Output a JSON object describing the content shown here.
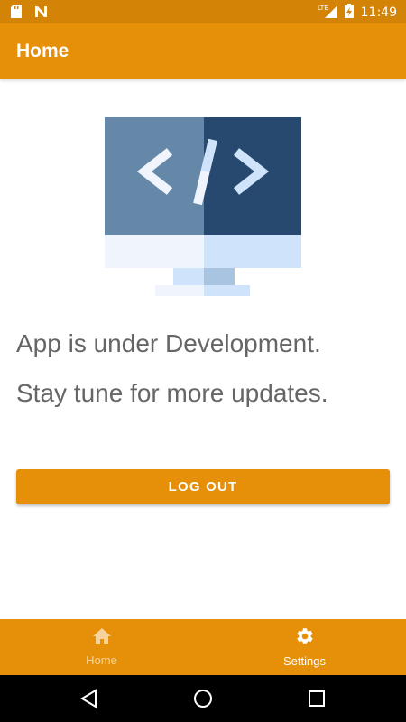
{
  "status_bar": {
    "network_label": "LTE",
    "time": "11:49",
    "icons": [
      "sd-card-icon",
      "n-notification-icon",
      "signal-icon",
      "battery-charging-icon"
    ]
  },
  "app_bar": {
    "title": "Home"
  },
  "content": {
    "illustration": "developer-code-monitor-icon",
    "message_line1": "App is under Development.",
    "message_line2": "Stay tune for more updates."
  },
  "logout_button": {
    "label": "LOG OUT"
  },
  "bottom_nav": {
    "items": [
      {
        "label": "Home",
        "icon": "home-icon"
      },
      {
        "label": "Settings",
        "icon": "gear-icon"
      }
    ]
  },
  "colors": {
    "primary": "#e68f08",
    "primary_dark": "#d38406",
    "text_gray": "#666666"
  }
}
